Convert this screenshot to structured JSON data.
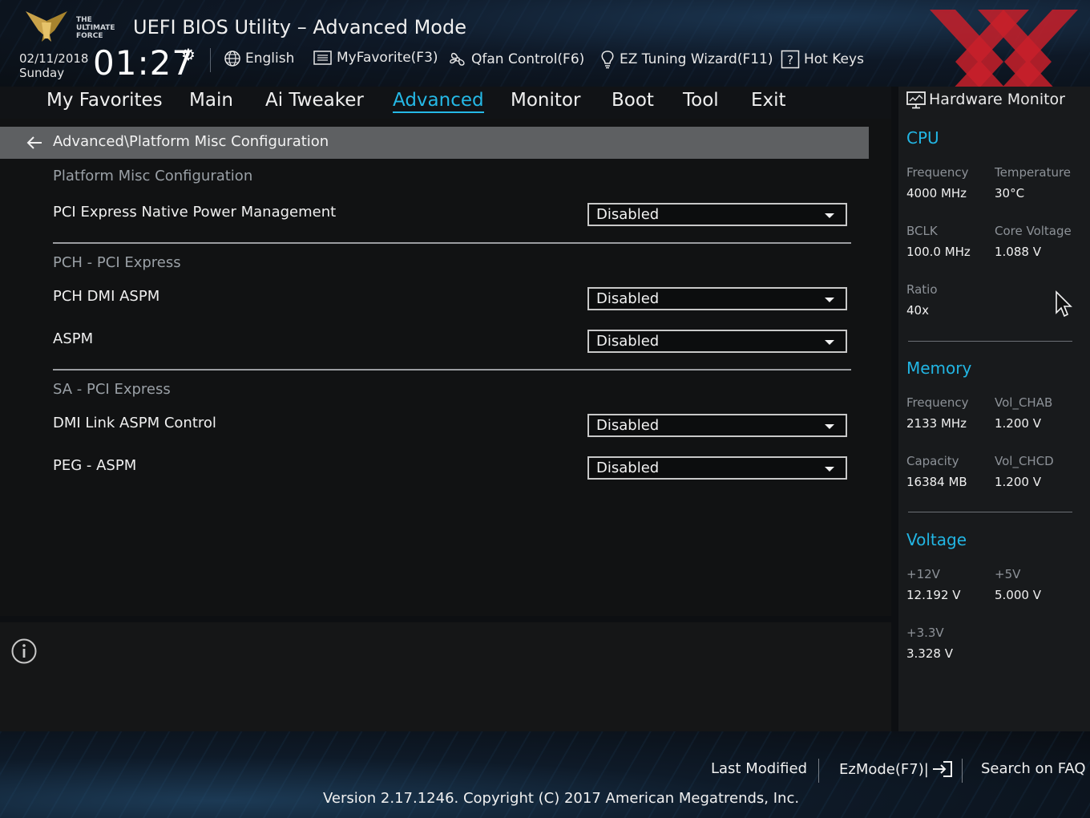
{
  "header": {
    "logo_text": "THE ULTIMATE FORCE",
    "title": "UEFI BIOS Utility – Advanced Mode",
    "date": "02/11/2018",
    "day": "Sunday",
    "time": "01:27",
    "language": "English",
    "myfavorite": "MyFavorite(F3)",
    "qfan": "Qfan Control(F6)",
    "ez_tuning": "EZ Tuning Wizard(F11)",
    "hot_keys": "Hot Keys"
  },
  "nav": {
    "tabs": [
      {
        "label": "My Favorites"
      },
      {
        "label": "Main"
      },
      {
        "label": "Ai Tweaker"
      },
      {
        "label": "Advanced"
      },
      {
        "label": "Monitor"
      },
      {
        "label": "Boot"
      },
      {
        "label": "Tool"
      },
      {
        "label": "Exit"
      }
    ],
    "active": "Advanced"
  },
  "breadcrumb": "Advanced\\Platform Misc Configuration",
  "sections": [
    {
      "title": "Platform Misc Configuration",
      "options": [
        {
          "label": "PCI Express Native Power Management",
          "value": "Disabled"
        }
      ]
    },
    {
      "title": "PCH - PCI Express",
      "options": [
        {
          "label": "PCH DMI ASPM",
          "value": "Disabled"
        },
        {
          "label": "ASPM",
          "value": "Disabled"
        }
      ]
    },
    {
      "title": "SA - PCI Express",
      "options": [
        {
          "label": "DMI Link ASPM Control",
          "value": "Disabled"
        },
        {
          "label": "PEG - ASPM",
          "value": "Disabled"
        }
      ]
    }
  ],
  "hardware_monitor": {
    "title": "Hardware Monitor",
    "cpu": {
      "heading": "CPU",
      "frequency_label": "Frequency",
      "frequency": "4000 MHz",
      "temperature_label": "Temperature",
      "temperature": "30°C",
      "bclk_label": "BCLK",
      "bclk": "100.0 MHz",
      "core_voltage_label": "Core Voltage",
      "core_voltage": "1.088 V",
      "ratio_label": "Ratio",
      "ratio": "40x"
    },
    "memory": {
      "heading": "Memory",
      "frequency_label": "Frequency",
      "frequency": "2133 MHz",
      "vol_chab_label": "Vol_CHAB",
      "vol_chab": "1.200 V",
      "capacity_label": "Capacity",
      "capacity": "16384 MB",
      "vol_chcd_label": "Vol_CHCD",
      "vol_chcd": "1.200 V"
    },
    "voltage": {
      "heading": "Voltage",
      "v12_label": "+12V",
      "v12": "12.192 V",
      "v5_label": "+5V",
      "v5": "5.000 V",
      "v33_label": "+3.3V",
      "v33": "3.328 V"
    }
  },
  "footer": {
    "last_modified": "Last Modified",
    "ezmode": "EzMode(F7)|",
    "search_faq": "Search on FAQ",
    "version": "Version 2.17.1246. Copyright (C) 2017 American Megatrends, Inc."
  },
  "colors": {
    "accent": "#25b9e6",
    "brand_x": "#c8202a",
    "breadcrumb_bg": "#5e6062"
  }
}
